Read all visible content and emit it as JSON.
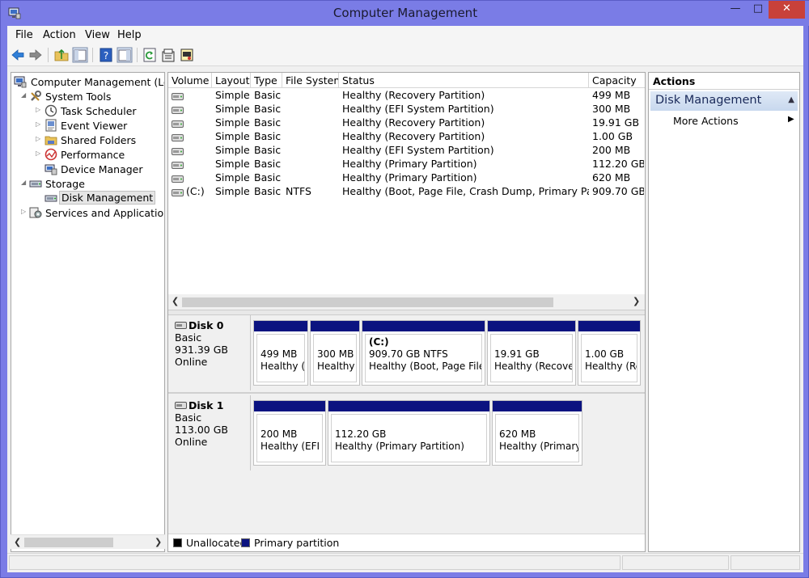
{
  "window": {
    "title": "Computer Management"
  },
  "menu": [
    "File",
    "Action",
    "View",
    "Help"
  ],
  "toolbar_icons": [
    "back-arrow-icon",
    "forward-arrow-icon",
    "up-folder-icon",
    "show-hide-tree-icon",
    "help-icon",
    "show-hide-action-pane-icon",
    "refresh-icon",
    "properties-icon",
    "disk-settings-icon"
  ],
  "tree": [
    {
      "label": "Computer Management (Local",
      "icon": "computer-icon",
      "level": 0,
      "expander": ""
    },
    {
      "label": "System Tools",
      "icon": "tools-icon",
      "level": 1,
      "expander": "◢"
    },
    {
      "label": "Task Scheduler",
      "icon": "clock-icon",
      "level": 2,
      "expander": "▷"
    },
    {
      "label": "Event Viewer",
      "icon": "event-viewer-icon",
      "level": 2,
      "expander": "▷"
    },
    {
      "label": "Shared Folders",
      "icon": "shared-folder-icon",
      "level": 2,
      "expander": "▷"
    },
    {
      "label": "Performance",
      "icon": "performance-icon",
      "level": 2,
      "expander": "▷"
    },
    {
      "label": "Device Manager",
      "icon": "device-manager-icon",
      "level": 2,
      "expander": ""
    },
    {
      "label": "Storage",
      "icon": "storage-icon",
      "level": 1,
      "expander": "◢"
    },
    {
      "label": "Disk Management",
      "icon": "disk-management-icon",
      "level": 2,
      "expander": "",
      "selected": true
    },
    {
      "label": "Services and Applications",
      "icon": "services-icon",
      "level": 1,
      "expander": "▷"
    }
  ],
  "volume_table": {
    "columns": [
      "Volume",
      "Layout",
      "Type",
      "File System",
      "Status",
      "Capacity"
    ],
    "rows": [
      {
        "volume": "",
        "layout": "Simple",
        "type": "Basic",
        "fs": "",
        "status": "Healthy (Recovery Partition)",
        "capacity": "499 MB"
      },
      {
        "volume": "",
        "layout": "Simple",
        "type": "Basic",
        "fs": "",
        "status": "Healthy (EFI System Partition)",
        "capacity": "300 MB"
      },
      {
        "volume": "",
        "layout": "Simple",
        "type": "Basic",
        "fs": "",
        "status": "Healthy (Recovery Partition)",
        "capacity": "19.91 GB"
      },
      {
        "volume": "",
        "layout": "Simple",
        "type": "Basic",
        "fs": "",
        "status": "Healthy (Recovery Partition)",
        "capacity": "1.00 GB"
      },
      {
        "volume": "",
        "layout": "Simple",
        "type": "Basic",
        "fs": "",
        "status": "Healthy (EFI System Partition)",
        "capacity": "200 MB"
      },
      {
        "volume": "",
        "layout": "Simple",
        "type": "Basic",
        "fs": "",
        "status": "Healthy (Primary Partition)",
        "capacity": "112.20 GB"
      },
      {
        "volume": "",
        "layout": "Simple",
        "type": "Basic",
        "fs": "",
        "status": "Healthy (Primary Partition)",
        "capacity": "620 MB"
      },
      {
        "volume": "(C:)",
        "layout": "Simple",
        "type": "Basic",
        "fs": "NTFS",
        "status": "Healthy (Boot, Page File, Crash Dump, Primary Partition)",
        "capacity": "909.70 GB"
      }
    ]
  },
  "disks": [
    {
      "name": "Disk 0",
      "type": "Basic",
      "size": "931.39 GB",
      "status": "Online",
      "partitions": [
        {
          "title": "",
          "line1": "499 MB",
          "line2": "Healthy (R"
        },
        {
          "title": "",
          "line1": "300 MB",
          "line2": "Healthy ("
        },
        {
          "title": "(C:)",
          "line1": "909.70 GB NTFS",
          "line2": "Healthy (Boot, Page File, C"
        },
        {
          "title": "",
          "line1": "19.91 GB",
          "line2": "Healthy (Recovery"
        },
        {
          "title": "",
          "line1": "1.00 GB",
          "line2": "Healthy (Rec"
        }
      ]
    },
    {
      "name": "Disk 1",
      "type": "Basic",
      "size": "113.00 GB",
      "status": "Online",
      "partitions": [
        {
          "title": "",
          "line1": "200 MB",
          "line2": "Healthy (EFI Sy"
        },
        {
          "title": "",
          "line1": "112.20 GB",
          "line2": "Healthy (Primary Partition)"
        },
        {
          "title": "",
          "line1": "620 MB",
          "line2": "Healthy (Primary P"
        }
      ]
    }
  ],
  "legend": [
    {
      "label": "Unallocated",
      "color": "#000000"
    },
    {
      "label": "Primary partition",
      "color": "#0b1380"
    }
  ],
  "actions": {
    "header": "Actions",
    "section": "Disk Management",
    "items": [
      {
        "label": "More Actions"
      }
    ]
  },
  "colors": {
    "title_bar": "#7a7ce6",
    "close_button": "#c8413a",
    "primary_partition": "#0b1380"
  }
}
